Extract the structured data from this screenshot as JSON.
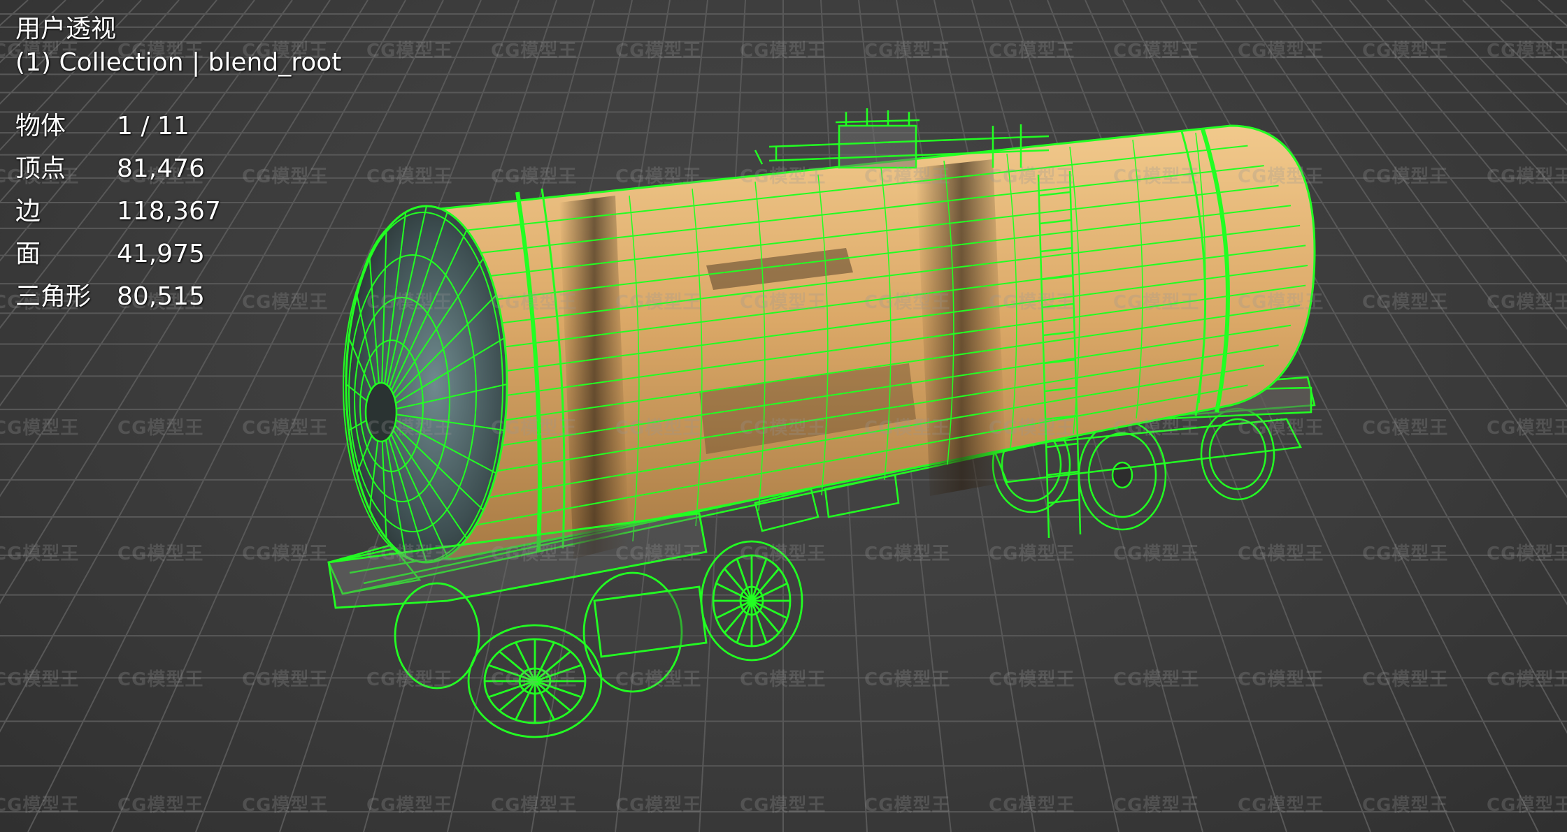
{
  "viewport": {
    "view_name": "用户透视",
    "collection_info": "(1) Collection | blend_root",
    "stats": [
      {
        "label": "物体",
        "value": "1 / 11"
      },
      {
        "label": "顶点",
        "value": "81,476"
      },
      {
        "label": "边",
        "value": "118,367"
      },
      {
        "label": "面",
        "value": "41,975"
      },
      {
        "label": "三角形",
        "value": "80,515"
      }
    ],
    "watermark_text": "CG模型王",
    "colors": {
      "background": "#3c3c3c",
      "grid": "#555555",
      "wireframe": "#22ff22",
      "tank": "#d9a865",
      "overlay_text": "#ffffff"
    }
  }
}
